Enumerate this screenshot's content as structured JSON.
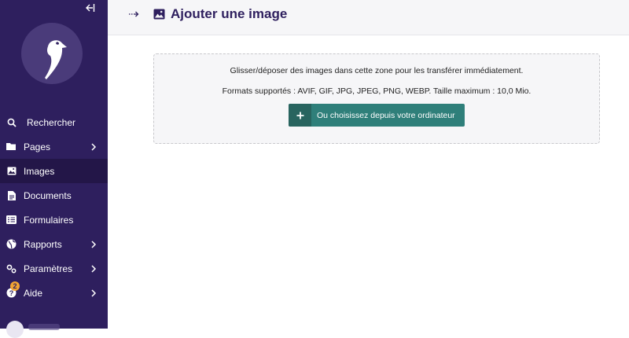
{
  "sidebar": {
    "collapse_icon": "collapse-left-icon",
    "logo": "wagtail-bird-logo",
    "items": [
      {
        "label": "Rechercher",
        "icon": "search-icon"
      },
      {
        "label": "Pages",
        "icon": "folder-icon",
        "has_submenu": true
      },
      {
        "label": "Images",
        "icon": "image-icon",
        "active": true
      },
      {
        "label": "Documents",
        "icon": "document-icon"
      },
      {
        "label": "Formulaires",
        "icon": "form-icon"
      },
      {
        "label": "Rapports",
        "icon": "globe-icon",
        "has_submenu": true
      },
      {
        "label": "Paramètres",
        "icon": "cogs-icon",
        "has_submenu": true
      },
      {
        "label": "Aide",
        "icon": "help-icon",
        "has_submenu": true,
        "badge": "2"
      }
    ]
  },
  "header": {
    "toggle_icon": "breadcrumb-expand-icon",
    "title_icon": "image-icon",
    "title": "Ajouter une image"
  },
  "dropzone": {
    "instruction": "Glisser/déposer des images dans cette zone pour les transférer immédiatement.",
    "formats": "Formats supportés : AVIF, GIF, JPG, JPEG, PNG, WEBP. Taille maximum : 10,0 Mio.",
    "button_label": "Ou choisissez depuis votre ordinateur",
    "button_icon": "plus-icon"
  },
  "colors": {
    "sidebar_bg": "#2e1f5e",
    "sidebar_active": "#231648",
    "button_teal": "#2f7f7a",
    "badge": "#f2a333"
  }
}
